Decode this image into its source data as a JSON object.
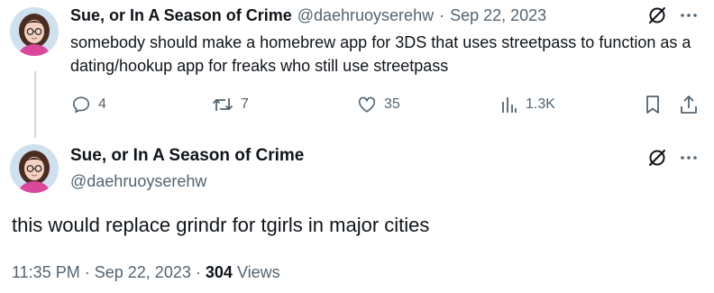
{
  "tweet1": {
    "display_name": "Sue, or In A Season of Crime",
    "handle": "@daehruoyserehw",
    "separator": "·",
    "date": "Sep 22, 2023",
    "text": "somebody should make a homebrew app for 3DS that uses streetpass to function as a dating/hookup app for freaks who still use streetpass",
    "actions": {
      "replies": "4",
      "reposts": "7",
      "likes": "35",
      "views": "1.3K"
    },
    "icons": {
      "top": [
        "grok-icon",
        "more-icon"
      ],
      "actions": [
        "reply-icon",
        "repost-icon",
        "like-icon",
        "views-icon",
        "bookmark-icon",
        "share-icon"
      ]
    }
  },
  "tweet2": {
    "display_name": "Sue, or In A Season of Crime",
    "handle": "@daehruoyserehw",
    "text": "this would replace grindr for tgirls in major cities",
    "time": "11:35 PM",
    "date": "Sep 22, 2023",
    "separator": "·",
    "views_count": "304",
    "views_label": "Views"
  },
  "colors": {
    "text": "#0f1419",
    "muted": "#536471",
    "thread_line": "#cfd9de",
    "background": "#ffffff"
  }
}
